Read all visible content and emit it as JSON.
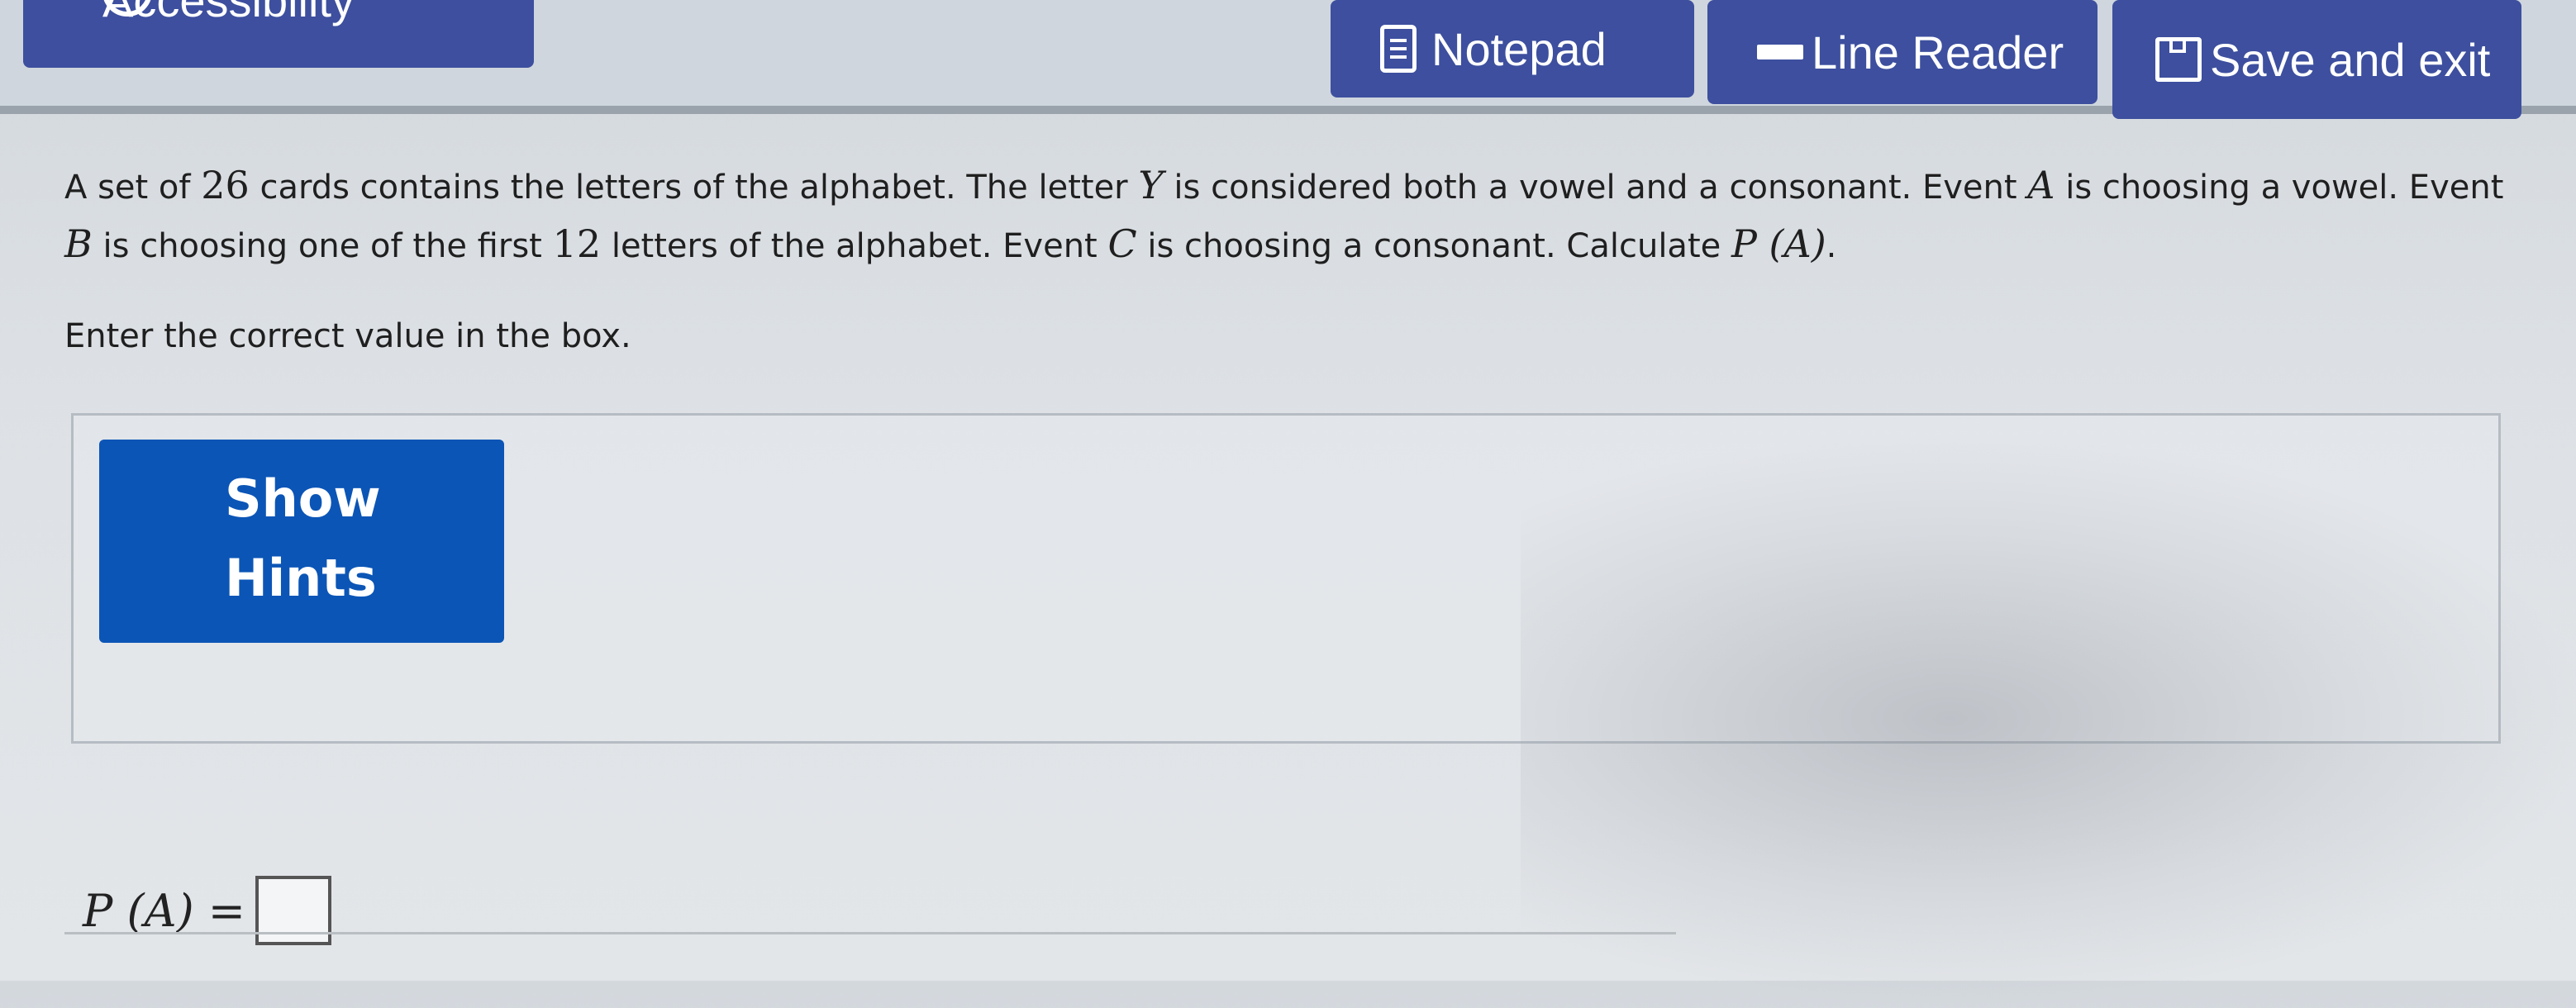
{
  "toolbar": {
    "accessibility_label": "Accessibility",
    "notepad_label": "Notepad",
    "line_reader_label": "Line Reader",
    "save_exit_label": "Save and exit"
  },
  "question": {
    "p1": "A set of ",
    "num26": "26",
    "p2": " cards contains the letters of the alphabet. The letter ",
    "varY": "Y",
    "p3": " is considered both a vowel and a consonant. Event ",
    "varA": "A",
    "p4": " is choosing a vowel. Event ",
    "varB": "B",
    "p5": " is choosing one of the first ",
    "num12": "12",
    "p6": " letters of the alphabet. Event ",
    "varC": "C",
    "p7": " is choosing a consonant. Calculate ",
    "calc": "P (A)",
    "p8": "."
  },
  "instruction": "Enter the correct value in the box.",
  "hints": {
    "line1": "Show",
    "line2": "Hints"
  },
  "answer": {
    "expr_left": "P (A) =",
    "value": ""
  }
}
